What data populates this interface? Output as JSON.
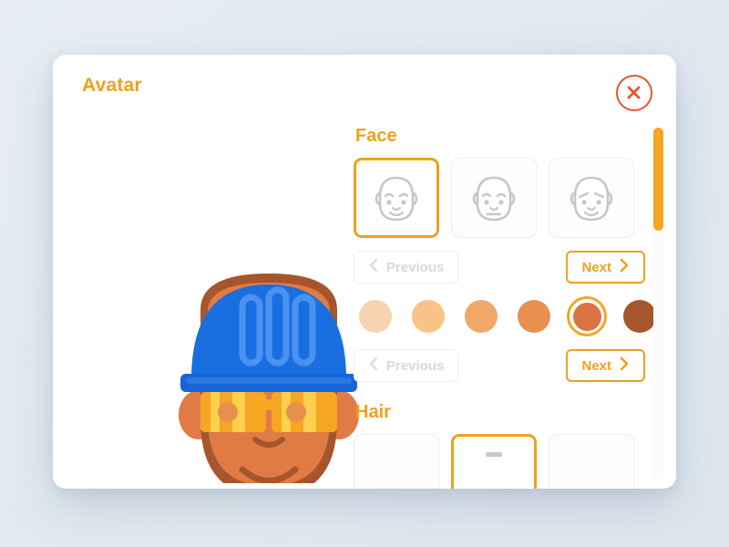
{
  "window": {
    "title": "Avatar",
    "close_icon": "close-circle-icon"
  },
  "theme": {
    "accent": "#F0A01E",
    "accent_alt": "#F5A623",
    "close_red": "#E7552B",
    "background": "#E3E9EF",
    "card": "#FFFFFF",
    "disabled_text": "#D8D8D8",
    "option_border": "#EDEDEE"
  },
  "preview": {
    "name": "avatar-preview",
    "helmet_color": "#1A6FE0",
    "helmet_ridge_color": "#4A92F0",
    "helmet_brim_color": "#1565D8",
    "skin_color": "#E07B45",
    "skin_shadow_color": "#A6562C",
    "goggles_color": "#F5A623",
    "goggles_highlight_color": "#FFD04D",
    "feature_line_color": "#A6562C"
  },
  "sections": [
    {
      "id": "face",
      "title": "Face",
      "options": [
        {
          "label": "face-smile",
          "selected": true,
          "mouth": "smile",
          "brows": "curved"
        },
        {
          "label": "face-neutral",
          "selected": false,
          "mouth": "straight",
          "brows": "curved"
        },
        {
          "label": "face-angled",
          "selected": false,
          "mouth": "smile",
          "brows": "angled"
        }
      ],
      "nav": {
        "previous_label": "Previous",
        "previous_enabled": false,
        "next_label": "Next",
        "next_enabled": true,
        "prev_icon": "chevron-left-icon",
        "next_icon": "chevron-right-icon"
      },
      "swatches": {
        "name": "skin-tone-swatches",
        "colors": [
          "#F7D3AF",
          "#F7C389",
          "#F0A86A",
          "#E8904F",
          "#DD7340",
          "#A6562C"
        ],
        "selected_index": 4
      },
      "swatch_nav": {
        "previous_label": "Previous",
        "previous_enabled": false,
        "next_label": "Next",
        "next_enabled": true,
        "prev_icon": "chevron-left-icon",
        "next_icon": "chevron-right-icon"
      }
    },
    {
      "id": "hair",
      "title": "Hair",
      "options": [
        {
          "label": "hair-style-1",
          "selected": false
        },
        {
          "label": "hair-style-2",
          "selected": true
        },
        {
          "label": "hair-style-3",
          "selected": false
        }
      ]
    }
  ],
  "scrollbar": {
    "name": "panel-scrollbar",
    "thumb_position_pct": 0,
    "thumb_size_pct": 29
  }
}
